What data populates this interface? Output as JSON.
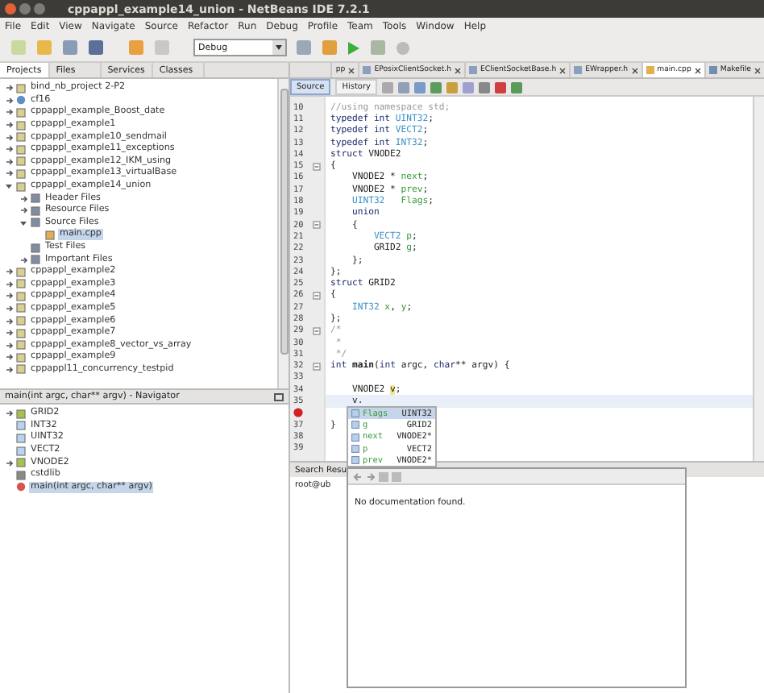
{
  "window": {
    "title": "cppappl_example14_union - NetBeans IDE 7.2.1"
  },
  "menu": [
    "File",
    "Edit",
    "View",
    "Navigate",
    "Source",
    "Refactor",
    "Run",
    "Debug",
    "Profile",
    "Team",
    "Tools",
    "Window",
    "Help"
  ],
  "toolbar": {
    "configuration": "Debug"
  },
  "left_tabs": [
    {
      "label": "Projects",
      "selected": true
    },
    {
      "label": "Files",
      "selected": false
    },
    {
      "label": "Services",
      "selected": false
    },
    {
      "label": "Classes",
      "selected": false
    }
  ],
  "projects": [
    {
      "label": "bind_nb_project 2-P2",
      "kind": "project",
      "expanded": false,
      "selected": false
    },
    {
      "label": "cf16",
      "kind": "globe",
      "expanded": false,
      "selected": false
    },
    {
      "label": "cppappl_example_Boost_date",
      "kind": "project",
      "expanded": false,
      "selected": false
    },
    {
      "label": "cppappl_example1",
      "kind": "project",
      "expanded": false,
      "selected": false
    },
    {
      "label": "cppappl_example10_sendmail",
      "kind": "project",
      "expanded": false,
      "selected": false
    },
    {
      "label": "cppappl_example11_exceptions",
      "kind": "project",
      "expanded": false,
      "selected": false
    },
    {
      "label": "cppappl_example12_IKM_using",
      "kind": "project",
      "expanded": false,
      "selected": false
    },
    {
      "label": "cppappl_example13_virtualBase",
      "kind": "project",
      "expanded": false,
      "selected": false
    },
    {
      "label": "cppappl_example14_union",
      "kind": "project",
      "expanded": true,
      "selected": false,
      "children": [
        {
          "label": "Header Files",
          "kind": "folder",
          "expanded": false,
          "selected": false
        },
        {
          "label": "Resource Files",
          "kind": "folder",
          "expanded": false,
          "selected": false
        },
        {
          "label": "Source Files",
          "kind": "folder",
          "expanded": true,
          "selected": false,
          "children": [
            {
              "label": "main.cpp",
              "kind": "file",
              "selected": true
            }
          ]
        },
        {
          "label": "Test Files",
          "kind": "folder",
          "selected": false
        },
        {
          "label": "Important Files",
          "kind": "folder",
          "expanded": false,
          "selected": false
        }
      ]
    },
    {
      "label": "cppappl_example2",
      "kind": "project",
      "expanded": false,
      "selected": false
    },
    {
      "label": "cppappl_example3",
      "kind": "project",
      "expanded": false,
      "selected": false
    },
    {
      "label": "cppappl_example4",
      "kind": "project",
      "expanded": false,
      "selected": false
    },
    {
      "label": "cppappl_example5",
      "kind": "project",
      "expanded": false,
      "selected": false
    },
    {
      "label": "cppappl_example6",
      "kind": "project",
      "expanded": false,
      "selected": false
    },
    {
      "label": "cppappl_example7",
      "kind": "project",
      "expanded": false,
      "selected": false
    },
    {
      "label": "cppappl_example8_vector_vs_array",
      "kind": "project",
      "expanded": false,
      "selected": false
    },
    {
      "label": "cppappl_example9",
      "kind": "project",
      "expanded": false,
      "selected": false
    },
    {
      "label": "cppappl11_concurrency_testpid",
      "kind": "project",
      "expanded": false,
      "selected": false
    }
  ],
  "navigator": {
    "title": "main(int argc, char** argv) - Navigator",
    "items": [
      {
        "label": "GRID2",
        "kind": "struct",
        "expanded": false,
        "selected": false
      },
      {
        "label": "INT32",
        "kind": "typedef",
        "selected": false
      },
      {
        "label": "UINT32",
        "kind": "typedef",
        "selected": false
      },
      {
        "label": "VECT2",
        "kind": "typedef",
        "selected": false
      },
      {
        "label": "VNODE2",
        "kind": "struct",
        "expanded": false,
        "selected": false
      },
      {
        "label": "cstdlib",
        "kind": "include",
        "selected": false
      },
      {
        "label": "main(int argc, char** argv)",
        "kind": "function",
        "selected": true
      }
    ]
  },
  "editor_tabs": [
    {
      "label": "pp",
      "selected": false
    },
    {
      "label": "EPosixClientSocket.h",
      "kind": "header",
      "selected": false
    },
    {
      "label": "EClientSocketBase.h",
      "kind": "header",
      "selected": false
    },
    {
      "label": "EWrapper.h",
      "kind": "header",
      "selected": false
    },
    {
      "label": "main.cpp",
      "kind": "source",
      "selected": true
    },
    {
      "label": "Makefile",
      "kind": "make",
      "selected": false
    }
  ],
  "view_tabs": [
    {
      "label": "Source",
      "selected": true
    },
    {
      "label": "History",
      "selected": false
    }
  ],
  "code": [
    {
      "number": "10",
      "tokens": [
        {
          "text": "//using namespace std;",
          "kind": "comment"
        }
      ]
    },
    {
      "number": "11",
      "tokens": [
        {
          "text": "typedef int ",
          "kind": "kw"
        },
        {
          "text": "UINT32",
          "kind": "type"
        },
        {
          "text": ";",
          "kind": "plain"
        }
      ]
    },
    {
      "number": "12",
      "tokens": [
        {
          "text": "typedef int ",
          "kind": "kw"
        },
        {
          "text": "VECT2",
          "kind": "type"
        },
        {
          "text": ";",
          "kind": "plain"
        }
      ]
    },
    {
      "number": "13",
      "tokens": [
        {
          "text": "typedef int ",
          "kind": "kw"
        },
        {
          "text": "INT32",
          "kind": "type"
        },
        {
          "text": ";",
          "kind": "plain"
        }
      ]
    },
    {
      "number": "14",
      "tokens": [
        {
          "text": "struct ",
          "kind": "kw"
        },
        {
          "text": "VNODE2",
          "kind": "plain"
        }
      ]
    },
    {
      "number": "15",
      "fold": true,
      "tokens": [
        {
          "text": "{",
          "kind": "plain"
        }
      ]
    },
    {
      "number": "16",
      "tokens": [
        {
          "text": "    VNODE2 * ",
          "kind": "plain"
        },
        {
          "text": "next",
          "kind": "ident"
        },
        {
          "text": ";",
          "kind": "plain"
        }
      ]
    },
    {
      "number": "17",
      "tokens": [
        {
          "text": "    VNODE2 * ",
          "kind": "plain"
        },
        {
          "text": "prev",
          "kind": "ident"
        },
        {
          "text": ";",
          "kind": "plain"
        }
      ]
    },
    {
      "number": "18",
      "tokens": [
        {
          "text": "    UINT32",
          "kind": "type"
        },
        {
          "text": "   Flags",
          "kind": "ident"
        },
        {
          "text": ";",
          "kind": "plain"
        }
      ]
    },
    {
      "number": "19",
      "tokens": [
        {
          "text": "    union",
          "kind": "kw"
        }
      ]
    },
    {
      "number": "20",
      "fold": true,
      "tokens": [
        {
          "text": "    {",
          "kind": "plain"
        }
      ]
    },
    {
      "number": "21",
      "tokens": [
        {
          "text": "        VECT2",
          "kind": "type"
        },
        {
          "text": " p",
          "kind": "ident"
        },
        {
          "text": ";",
          "kind": "plain"
        }
      ]
    },
    {
      "number": "22",
      "tokens": [
        {
          "text": "        GRID2 ",
          "kind": "plain"
        },
        {
          "text": "g",
          "kind": "ident"
        },
        {
          "text": ";",
          "kind": "plain"
        }
      ]
    },
    {
      "number": "23",
      "tokens": [
        {
          "text": "    };",
          "kind": "plain"
        }
      ]
    },
    {
      "number": "24",
      "tokens": [
        {
          "text": "};",
          "kind": "plain"
        }
      ]
    },
    {
      "number": "25",
      "tokens": [
        {
          "text": "struct ",
          "kind": "kw"
        },
        {
          "text": "GRID2",
          "kind": "plain"
        }
      ]
    },
    {
      "number": "26",
      "fold": true,
      "tokens": [
        {
          "text": "{",
          "kind": "plain"
        }
      ]
    },
    {
      "number": "27",
      "tokens": [
        {
          "text": "    INT32",
          "kind": "type"
        },
        {
          "text": " x",
          "kind": "ident"
        },
        {
          "text": ", ",
          "kind": "plain"
        },
        {
          "text": "y",
          "kind": "ident"
        },
        {
          "text": ";",
          "kind": "plain"
        }
      ]
    },
    {
      "number": "28",
      "tokens": [
        {
          "text": "};",
          "kind": "plain"
        }
      ]
    },
    {
      "number": "29",
      "fold": true,
      "tokens": [
        {
          "text": "/*",
          "kind": "comment"
        }
      ]
    },
    {
      "number": "30",
      "tokens": [
        {
          "text": " *",
          "kind": "comment"
        }
      ]
    },
    {
      "number": "31",
      "tokens": [
        {
          "text": " */",
          "kind": "comment"
        }
      ]
    },
    {
      "number": "32",
      "fold": true,
      "tokens": [
        {
          "text": "int ",
          "kind": "kw"
        },
        {
          "text": "main",
          "kind": "bold"
        },
        {
          "text": "(",
          "kind": "plain"
        },
        {
          "text": "int ",
          "kind": "kw"
        },
        {
          "text": "argc, ",
          "kind": "plain"
        },
        {
          "text": "char",
          "kind": "kw"
        },
        {
          "text": "** argv) {",
          "kind": "plain"
        }
      ]
    },
    {
      "number": "33"
    },
    {
      "number": "34",
      "tokens": [
        {
          "text": "    VNODE2 ",
          "kind": "plain"
        },
        {
          "text": "v",
          "kind": "mark"
        },
        {
          "text": ";",
          "kind": "plain"
        }
      ]
    },
    {
      "number": "35",
      "current": true,
      "tokens": [
        {
          "text": "    v.",
          "kind": "plain"
        }
      ]
    },
    {
      "error": true
    },
    {
      "number": "37",
      "tokens": [
        {
          "text": "}",
          "kind": "plain"
        }
      ]
    },
    {
      "number": "38"
    },
    {
      "number": "39"
    }
  ],
  "completion": [
    {
      "name": "Flags",
      "type": "UINT32",
      "kind": "field",
      "selected": true
    },
    {
      "name": "g",
      "type": "GRID2",
      "kind": "field",
      "selected": false
    },
    {
      "name": "next",
      "type": "VNODE2*",
      "kind": "field",
      "selected": false
    },
    {
      "name": "p",
      "type": "VECT2",
      "kind": "field",
      "selected": false
    },
    {
      "name": "prev",
      "type": "VNODE2*",
      "kind": "field",
      "selected": false
    }
  ],
  "documentation": {
    "text": "No documentation found."
  },
  "output": {
    "tab": "Search Resu",
    "line": "root@ub"
  }
}
